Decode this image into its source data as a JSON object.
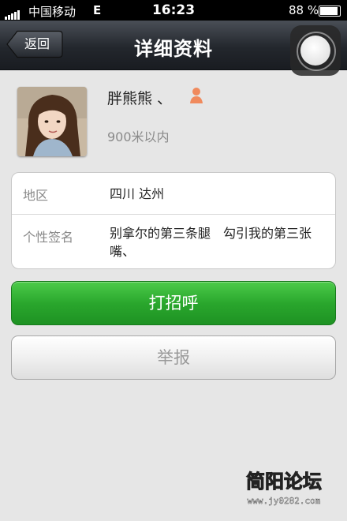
{
  "status_bar": {
    "carrier": "中国移动",
    "network": "E",
    "time": "16:23",
    "battery": "88 %",
    "battery_level": 0.88
  },
  "nav": {
    "back_label": "返回",
    "title": "详细资料"
  },
  "profile": {
    "name": "胖熊熊 、",
    "distance": "900米以内"
  },
  "details": [
    {
      "label": "地区",
      "value": "四川 达州"
    },
    {
      "label": "个性签名",
      "value": "别拿尔的第三条腿　勾引我的第三张嘴、"
    }
  ],
  "actions": {
    "greet_label": "打招呼",
    "report_label": "举报"
  },
  "watermark": {
    "title": "简阳论坛",
    "url": "www.jy0282.com"
  },
  "colors": {
    "accent_green": "#2aa72d",
    "gender_icon": "#f08a5d",
    "nav_bar": "#23272d"
  }
}
